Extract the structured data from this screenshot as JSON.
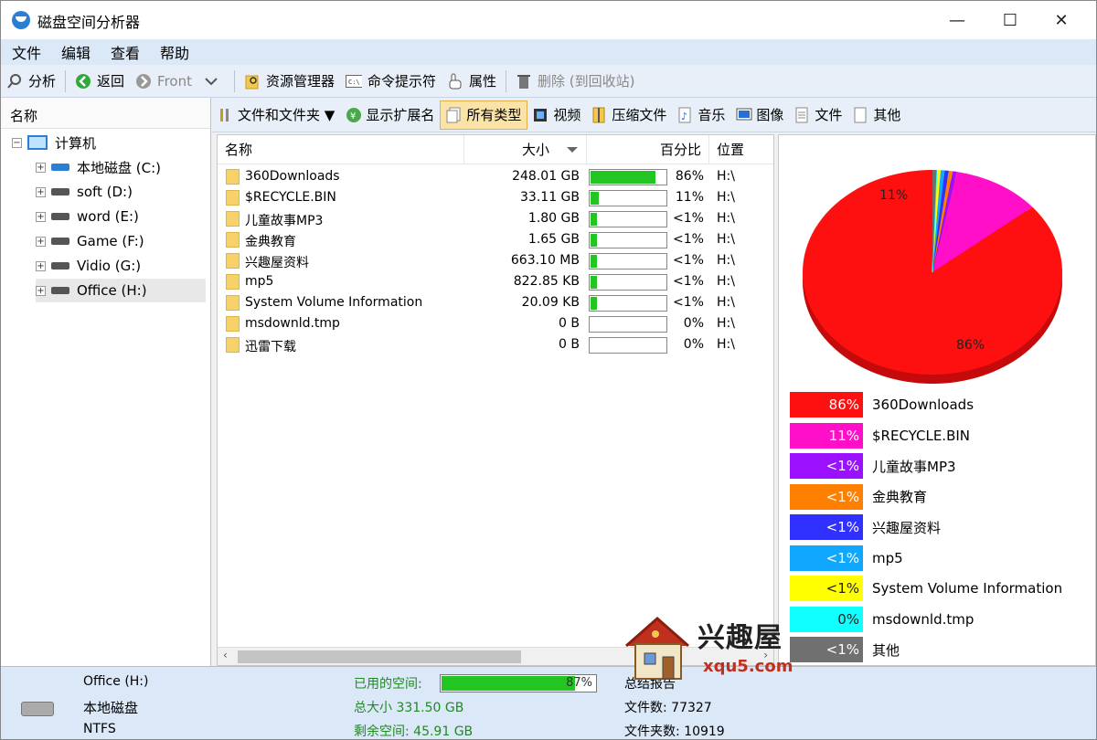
{
  "window": {
    "title": "磁盘空间分析器"
  },
  "menu": [
    "文件",
    "编辑",
    "查看",
    "帮助"
  ],
  "toolbar": {
    "analyze": "分析",
    "back": "返回",
    "front": "Front",
    "explorer": "资源管理器",
    "cmd": "命令提示符",
    "props": "属性",
    "delete": "删除 (到回收站)"
  },
  "tree": {
    "header": "名称",
    "root": "计算机",
    "drives": [
      "本地磁盘 (C:)",
      "soft (D:)",
      "word (E:)",
      "Game (F:)",
      "Vidio (G:)",
      "Office (H:)"
    ]
  },
  "filters": {
    "files_folders": "文件和文件夹 ▼",
    "show_ext": "显示扩展名",
    "all_types": "所有类型",
    "video": "视频",
    "archive": "压缩文件",
    "music": "音乐",
    "image": "图像",
    "docs": "文件",
    "other": "其他"
  },
  "list": {
    "columns": {
      "name": "名称",
      "size": "大小",
      "percent": "百分比",
      "location": "位置"
    },
    "rows": [
      {
        "name": "360Downloads",
        "size": "248.01 GB",
        "pct": "86%",
        "fill": 0.86,
        "loc": "H:\\"
      },
      {
        "name": "$RECYCLE.BIN",
        "size": "33.11 GB",
        "pct": "11%",
        "fill": 0.11,
        "loc": "H:\\"
      },
      {
        "name": "儿童故事MP3",
        "size": "1.80 GB",
        "pct": "<1%",
        "fill": 0.01,
        "loc": "H:\\"
      },
      {
        "name": "金典教育",
        "size": "1.65 GB",
        "pct": "<1%",
        "fill": 0.01,
        "loc": "H:\\"
      },
      {
        "name": "兴趣屋资料",
        "size": "663.10 MB",
        "pct": "<1%",
        "fill": 0.01,
        "loc": "H:\\"
      },
      {
        "name": "mp5",
        "size": "822.85 KB",
        "pct": "<1%",
        "fill": 0.01,
        "loc": "H:\\"
      },
      {
        "name": "System Volume Information",
        "size": "20.09 KB",
        "pct": "<1%",
        "fill": 0.01,
        "loc": "H:\\"
      },
      {
        "name": "msdownld.tmp",
        "size": "0 B",
        "pct": "0%",
        "fill": 0,
        "loc": "H:\\"
      },
      {
        "name": "迅雷下载",
        "size": "0 B",
        "pct": "0%",
        "fill": 0,
        "loc": "H:\\"
      }
    ]
  },
  "chart_data": {
    "type": "pie",
    "slices": [
      {
        "label": "86%",
        "value": 86,
        "color": "#ff1010"
      },
      {
        "label": "11%",
        "value": 11,
        "color": "#ff10c8"
      },
      {
        "label": "<1%",
        "value": 0.5,
        "color": "#9b10ff"
      },
      {
        "label": "<1%",
        "value": 0.5,
        "color": "#ff8000"
      },
      {
        "label": "<1%",
        "value": 0.5,
        "color": "#3030ff"
      },
      {
        "label": "<1%",
        "value": 0.5,
        "color": "#10a8ff"
      },
      {
        "label": "<1%",
        "value": 0.5,
        "color": "#ffff00"
      },
      {
        "label": "0%",
        "value": 0.0,
        "color": "#10ffff"
      },
      {
        "label": "<1%",
        "value": 0.5,
        "color": "#707070"
      }
    ],
    "legend": [
      {
        "pct": "86%",
        "name": "360Downloads",
        "color": "#ff1010"
      },
      {
        "pct": "11%",
        "name": "$RECYCLE.BIN",
        "color": "#ff10c8"
      },
      {
        "pct": "<1%",
        "name": "儿童故事MP3",
        "color": "#9b10ff"
      },
      {
        "pct": "<1%",
        "name": "金典教育",
        "color": "#ff8000"
      },
      {
        "pct": "<1%",
        "name": "兴趣屋资料",
        "color": "#3030ff"
      },
      {
        "pct": "<1%",
        "name": "mp5",
        "color": "#10a8ff"
      },
      {
        "pct": "<1%",
        "name": "System Volume Information",
        "color": "#ffff00"
      },
      {
        "pct": "0%",
        "name": "msdownld.tmp",
        "color": "#10ffff"
      },
      {
        "pct": "<1%",
        "name": "其他",
        "color": "#707070"
      }
    ]
  },
  "status": {
    "drive_name": "Office (H:)",
    "drive_type": "本地磁盘",
    "fs": "NTFS",
    "used_label": "已用的空间:",
    "used_pct": "87%",
    "used_fill": 0.87,
    "total": "总大小 331.50 GB",
    "free": "剩余空间: 45.91 GB",
    "summary": "总结报告",
    "files": "文件数: 77327",
    "folders": "文件夹数: 10919"
  },
  "watermark": {
    "cn": "兴趣屋",
    "url": "xqu5.com"
  }
}
